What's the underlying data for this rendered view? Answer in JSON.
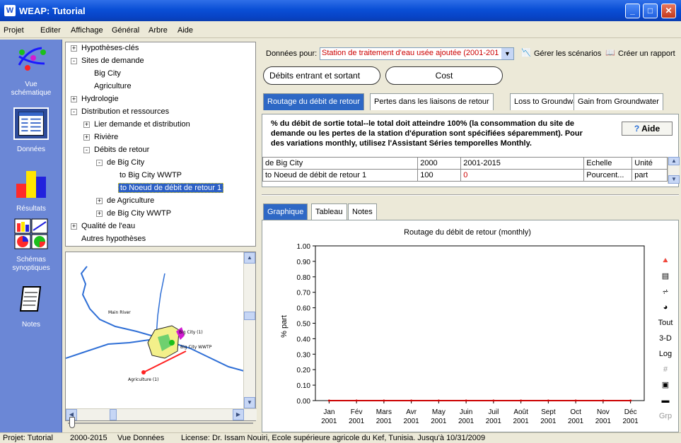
{
  "window": {
    "title": "WEAP: Tutorial",
    "app_icon": "W"
  },
  "menu": [
    "Projet",
    "Editer",
    "Affichage",
    "Général",
    "Arbre",
    "Aide"
  ],
  "nav": [
    {
      "label_lines": [
        "Vue",
        "schématique"
      ],
      "icon": "schematic-icon"
    },
    {
      "label_lines": [
        "Données"
      ],
      "icon": "data-icon"
    },
    {
      "label_lines": [
        "Résultats"
      ],
      "icon": "results-icon"
    },
    {
      "label_lines": [
        "Schémas",
        "synoptiques"
      ],
      "icon": "overviews-icon"
    },
    {
      "label_lines": [
        "Notes"
      ],
      "icon": "notes-icon"
    }
  ],
  "tree": [
    {
      "label": "Hypothèses-clés",
      "pm": "+"
    },
    {
      "label": "Sites de demande",
      "pm": "-"
    },
    {
      "label": "Big City",
      "pm": ""
    },
    {
      "label": "Agriculture",
      "pm": ""
    },
    {
      "label": "Hydrologie",
      "pm": "+"
    },
    {
      "label": "Distribution et ressources",
      "pm": "-"
    },
    {
      "label": "Lier demande et distribution",
      "pm": "+"
    },
    {
      "label": "Rivière",
      "pm": "+"
    },
    {
      "label": "Débits de retour",
      "pm": "-"
    },
    {
      "label": "de Big City",
      "pm": "-"
    },
    {
      "label": "to Big City WWTP",
      "pm": ""
    },
    {
      "label": "to Noeud de débit de retour 1",
      "pm": "",
      "selected": true
    },
    {
      "label": "de Agriculture",
      "pm": "+"
    },
    {
      "label": "de Big City WWTP",
      "pm": "+"
    },
    {
      "label": "Qualité de l'eau",
      "pm": "+"
    },
    {
      "label": "Autres hypothèses",
      "pm": ""
    }
  ],
  "map": {
    "labels": {
      "river": "Main River",
      "city": "Big City (1)",
      "wwtp": "Big City WWTP",
      "agri": "Agriculture (1)"
    }
  },
  "data_for": {
    "label": "Données pour:",
    "value": "Station de traitement d'eau usée ajoutée (2001-201",
    "manage": "Gérer les scénarios",
    "report": "Créer un rapport"
  },
  "pills": [
    "Débits entrant et sortant",
    "Cost"
  ],
  "tabs": [
    "Routage du débit de retour",
    "Pertes dans les liaisons de retour",
    "Loss to Groundwater",
    "Gain from Groundwater"
  ],
  "info": {
    "text": "% du débit de sortie total--le total doit atteindre 100% (la consommation du site de demande ou les pertes de la station d'épuration sont spécifiées séparemment). Pour des variations monthly, utilisez l'Assistant Séries temporelles Monthly.",
    "help": "Aide"
  },
  "grid": {
    "header": [
      "de Big City",
      "2000",
      "2001-2015",
      "Echelle",
      "Unité"
    ],
    "row": [
      "to Noeud de débit de retour 1",
      "100",
      "0",
      "Pourcent...",
      "part"
    ]
  },
  "chart_tabs": [
    "Graphique",
    "Tableau",
    "Notes"
  ],
  "chart_tools": [
    "Tout",
    "3-D",
    "Log",
    "Grp"
  ],
  "chart_data": {
    "type": "line",
    "title": "Routage du débit de retour (monthly)",
    "ylabel": "% part",
    "xlabel": "",
    "categories": [
      {
        "month": "Jan",
        "year": "2001"
      },
      {
        "month": "Fév",
        "year": "2001"
      },
      {
        "month": "Mars",
        "year": "2001"
      },
      {
        "month": "Avr",
        "year": "2001"
      },
      {
        "month": "May",
        "year": "2001"
      },
      {
        "month": "Juin",
        "year": "2001"
      },
      {
        "month": "Juil",
        "year": "2001"
      },
      {
        "month": "Août",
        "year": "2001"
      },
      {
        "month": "Sept",
        "year": "2001"
      },
      {
        "month": "Oct",
        "year": "2001"
      },
      {
        "month": "Nov",
        "year": "2001"
      },
      {
        "month": "Déc",
        "year": "2001"
      }
    ],
    "series": [
      {
        "values": [
          0,
          0,
          0,
          0,
          0,
          0,
          0,
          0,
          0,
          0,
          0,
          0
        ],
        "color": "#cc0000"
      }
    ],
    "ylim": [
      0,
      1
    ],
    "yticks": [
      "1.00",
      "0.90",
      "0.80",
      "0.70",
      "0.60",
      "0.50",
      "0.40",
      "0.30",
      "0.20",
      "0.10",
      "0.00"
    ]
  },
  "status": [
    "Projet: Tutorial",
    "2000-2015",
    "Vue Données",
    "License: Dr. Issam Nouiri, Ecole supérieure agricole du Kef, Tunisia. Jusqu'à 10/31/2009"
  ]
}
